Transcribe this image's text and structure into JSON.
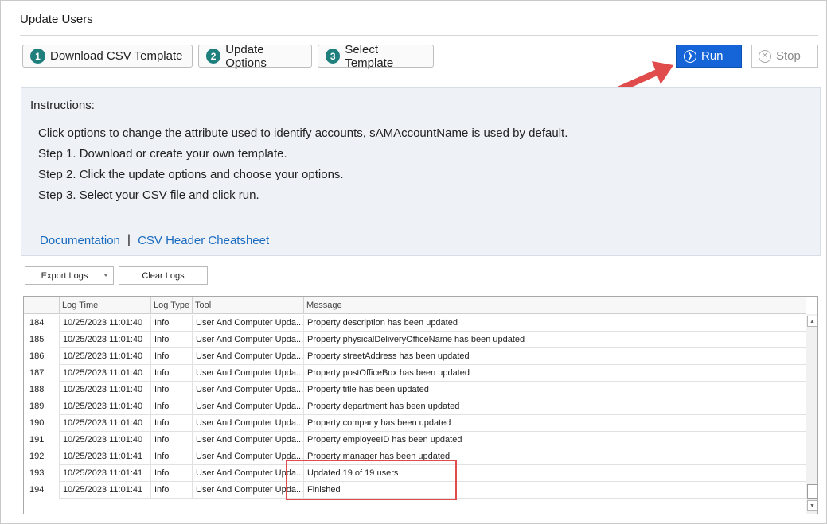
{
  "window": {
    "title": "Update Users"
  },
  "toolbar": {
    "steps": [
      {
        "number": "1",
        "label": "Download CSV Template"
      },
      {
        "number": "2",
        "label": "Update Options"
      },
      {
        "number": "3",
        "label": "Select Template"
      }
    ],
    "run_label": "Run",
    "stop_label": "Stop",
    "run_icon": "play-circle-icon",
    "stop_icon": "stop-circle-icon"
  },
  "instructions": {
    "heading": "Instructions:",
    "lines": [
      "Click options to change the attribute used to identify accounts, sAMAccountName is used by default.",
      "Step 1. Download or create your own template.",
      "Step 2. Click the update options and choose your options.",
      "Step 3. Select your CSV file and click run."
    ],
    "links": {
      "documentation": "Documentation",
      "separator": "|",
      "cheatsheet": "CSV Header Cheatsheet"
    }
  },
  "logs_toolbar": {
    "export_label": "Export Logs",
    "clear_label": "Clear Logs"
  },
  "log_grid": {
    "columns": [
      "Log Time",
      "Log Type",
      "Tool",
      "Message"
    ],
    "rows": [
      {
        "id": "184",
        "time": "10/25/2023 11:01:40",
        "type": "Info",
        "tool": "User And Computer Upda...",
        "message": "Property description has been updated"
      },
      {
        "id": "185",
        "time": "10/25/2023 11:01:40",
        "type": "Info",
        "tool": "User And Computer Upda...",
        "message": "Property physicalDeliveryOfficeName has been updated"
      },
      {
        "id": "186",
        "time": "10/25/2023 11:01:40",
        "type": "Info",
        "tool": "User And Computer Upda...",
        "message": "Property streetAddress has been updated"
      },
      {
        "id": "187",
        "time": "10/25/2023 11:01:40",
        "type": "Info",
        "tool": "User And Computer Upda...",
        "message": "Property postOfficeBox has been updated"
      },
      {
        "id": "188",
        "time": "10/25/2023 11:01:40",
        "type": "Info",
        "tool": "User And Computer Upda...",
        "message": "Property title has been updated"
      },
      {
        "id": "189",
        "time": "10/25/2023 11:01:40",
        "type": "Info",
        "tool": "User And Computer Upda...",
        "message": "Property department has been updated"
      },
      {
        "id": "190",
        "time": "10/25/2023 11:01:40",
        "type": "Info",
        "tool": "User And Computer Upda...",
        "message": "Property company has been updated"
      },
      {
        "id": "191",
        "time": "10/25/2023 11:01:40",
        "type": "Info",
        "tool": "User And Computer Upda...",
        "message": "Property employeeID has been updated"
      },
      {
        "id": "192",
        "time": "10/25/2023 11:01:41",
        "type": "Info",
        "tool": "User And Computer Upda...",
        "message": "Property manager has been updated"
      },
      {
        "id": "193",
        "time": "10/25/2023 11:01:41",
        "type": "Info",
        "tool": "User And Computer Upda...",
        "message": "Updated 19 of 19 users"
      },
      {
        "id": "194",
        "time": "10/25/2023 11:01:41",
        "type": "Info",
        "tool": "User And Computer Upda...",
        "message": "Finished"
      }
    ]
  },
  "colors": {
    "accent": "#1565d8",
    "step_badge": "#1e7f7c",
    "link": "#1a6bbf",
    "annotation": "#e04b4b",
    "panel_bg": "#eef2f7"
  }
}
